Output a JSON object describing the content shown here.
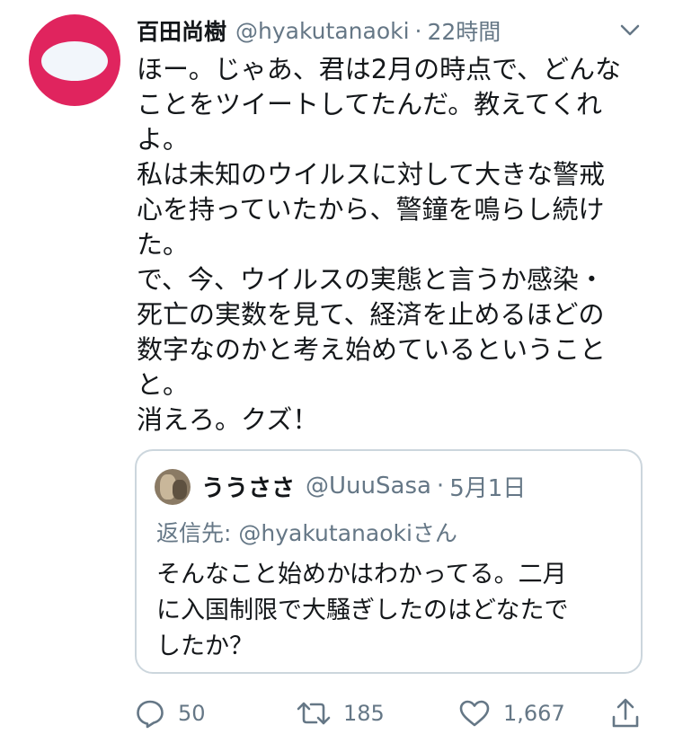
{
  "tweet": {
    "author_name": "百田尚樹",
    "handle": "@hyakutanaoki",
    "separator": "·",
    "time": "22時間",
    "body_lines": [
      "ほー。じゃあ、君は2月の時点で、どんな",
      "ことをツイートしてたんだ。教えてくれ",
      "よ。",
      "私は未知のウイルスに対して大きな警戒",
      "心を持っていたから、警鐘を鳴らし続け",
      "た。",
      "で、今、ウイルスの実態と言うか感染・",
      "死亡の実数を見て、経済を止めるほどの",
      "数字なのかと考え始めているということ",
      "と。",
      "消えろ。クズ！"
    ]
  },
  "quoted": {
    "author_name": "ううささ",
    "handle": "@UuuSasa",
    "separator": "·",
    "date": "5月1日",
    "reply_prefix": "返信先:",
    "reply_mention": "@hyakutanaoki",
    "reply_suffix": "さん",
    "body_lines": [
      "そんなこと始めかはわかってる。二月",
      "に入国制限で大騒ぎしたのはどなたで",
      "したか？"
    ]
  },
  "actions": {
    "reply_count": "50",
    "retweet_count": "185",
    "like_count": "1,667"
  },
  "colors": {
    "avatar": "#e0245e",
    "muted_text": "#657786",
    "border": "#ccd6dd"
  },
  "icons": [
    "chevron-down-icon",
    "reply-icon",
    "retweet-icon",
    "like-icon",
    "share-icon"
  ]
}
